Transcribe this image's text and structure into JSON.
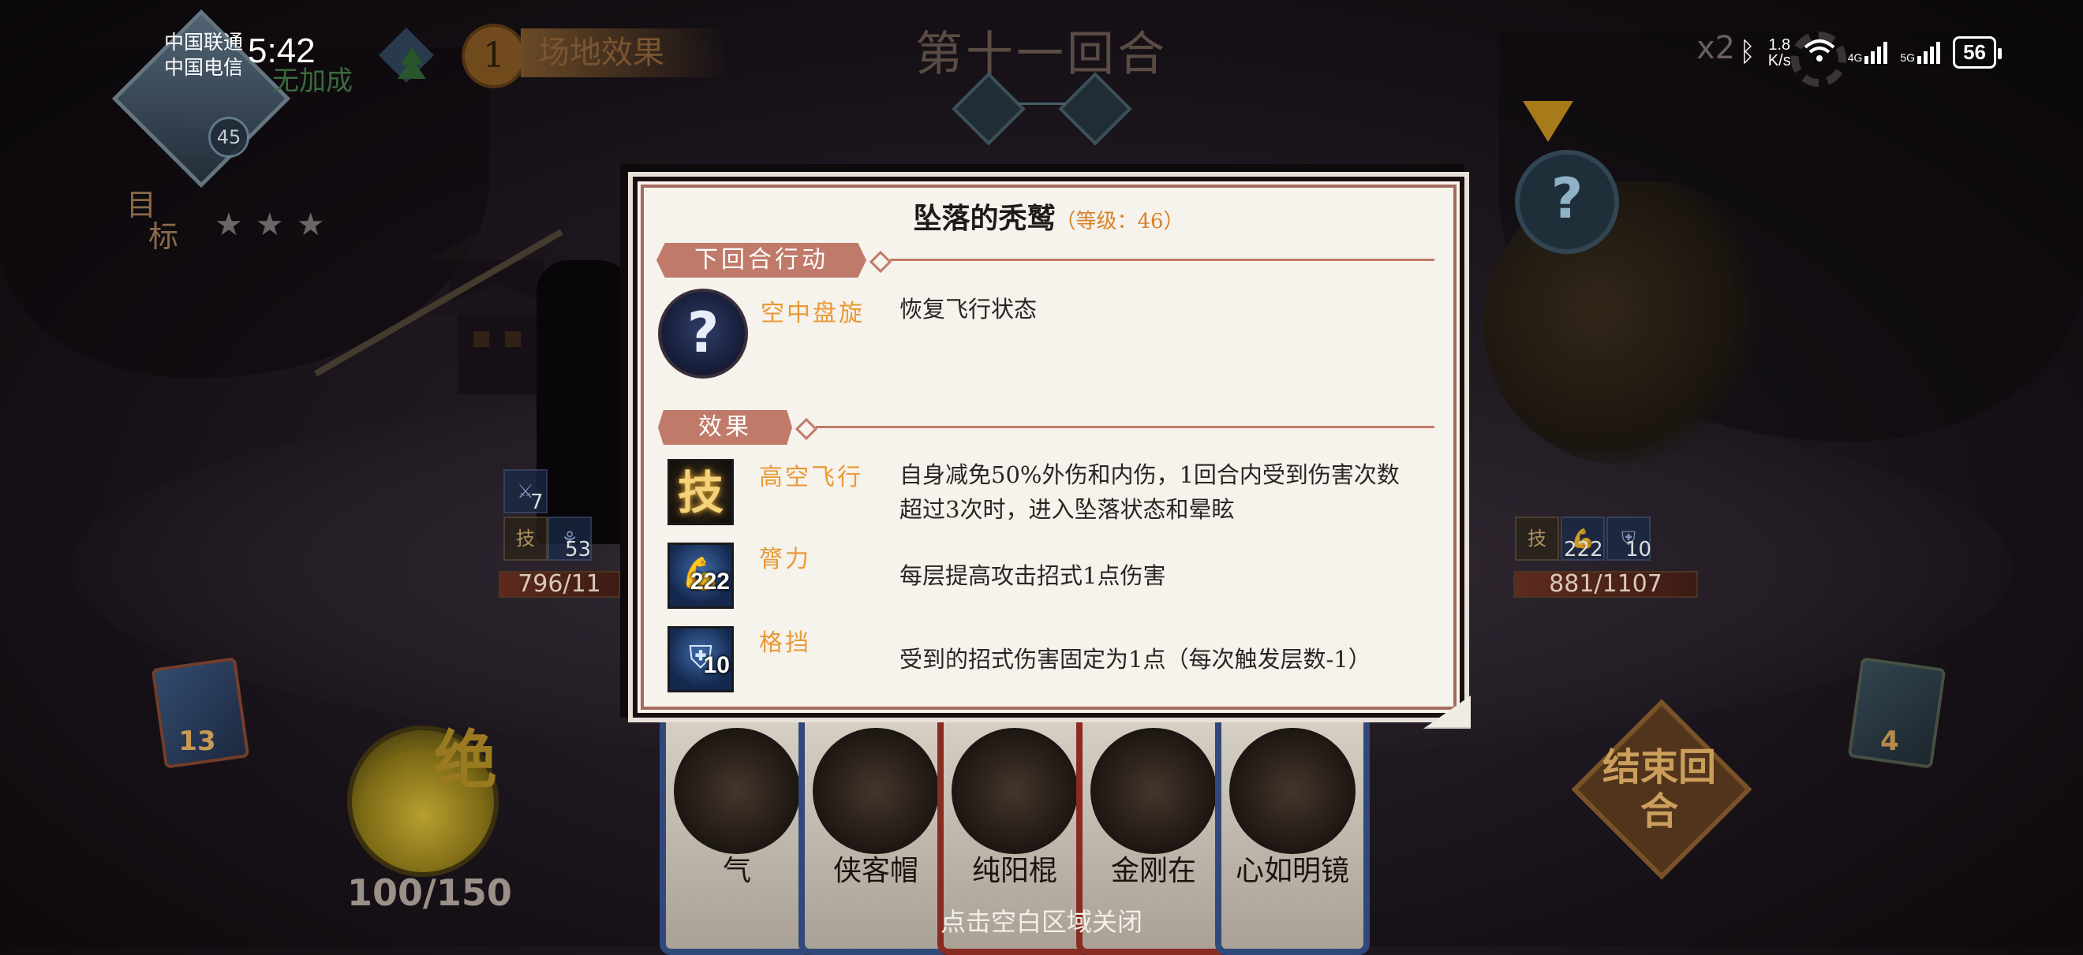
{
  "status_bar": {
    "carrier1": "中国联通",
    "carrier2": "中国电信",
    "time": "5:42",
    "speed_value": "1.8",
    "speed_unit": "K/s",
    "net1": "4G",
    "net2": "5G",
    "battery": "56"
  },
  "hud": {
    "player_level": "45",
    "bonus_text": "无加成",
    "turn_badge": "1",
    "field_effect": "场地效果",
    "round_title": "第十一回合",
    "target_label_1": "目",
    "target_label_2": "标",
    "stars": "★★★",
    "speed_label": "x2",
    "enemy_marker": "?"
  },
  "player": {
    "buff_top_count": "7",
    "buff_skill": "技",
    "buff_skill_count": "53",
    "hp": "796/11"
  },
  "enemy": {
    "buff_skill": "技",
    "buff1_count": "222",
    "buff2_count": "10",
    "hp": "881/1107"
  },
  "bottom": {
    "deck_left_count": "13",
    "deck_right_count": "4",
    "ultimate": "绝",
    "energy": "100/150",
    "end_turn": "结束回合",
    "close_hint": "点击空白区域关闭",
    "cards": [
      {
        "name": "气"
      },
      {
        "name": "侠客帽"
      },
      {
        "name": "纯阳棍"
      },
      {
        "name": "金刚在"
      },
      {
        "name": "心如明镜"
      }
    ]
  },
  "dialog": {
    "title": "坠落的秃鹫",
    "level": "（等级：46）",
    "next_action_tab": "下回合行动",
    "effects_tab": "效果",
    "next_action": {
      "icon": "?",
      "name": "空中盘旋",
      "desc": "恢复飞行状态"
    },
    "effects": [
      {
        "icon": "技",
        "count": "",
        "name": "高空飞行",
        "desc": "自身减免50%外伤和内伤，1回合内受到伤害次数超过3次时，进入坠落状态和晕眩"
      },
      {
        "icon": "flex-icon",
        "count": "222",
        "name": "膂力",
        "desc": "每层提高攻击招式1点伤害"
      },
      {
        "icon": "block-icon",
        "count": "10",
        "name": "格挡",
        "desc": "受到的招式伤害固定为1点（每次触发层数-1）"
      }
    ]
  },
  "colors": {
    "tab": "#c07a6a",
    "effect_name": "#e99a36",
    "level_text": "#d9822a",
    "dialog_bg": "#f6f2ec"
  }
}
